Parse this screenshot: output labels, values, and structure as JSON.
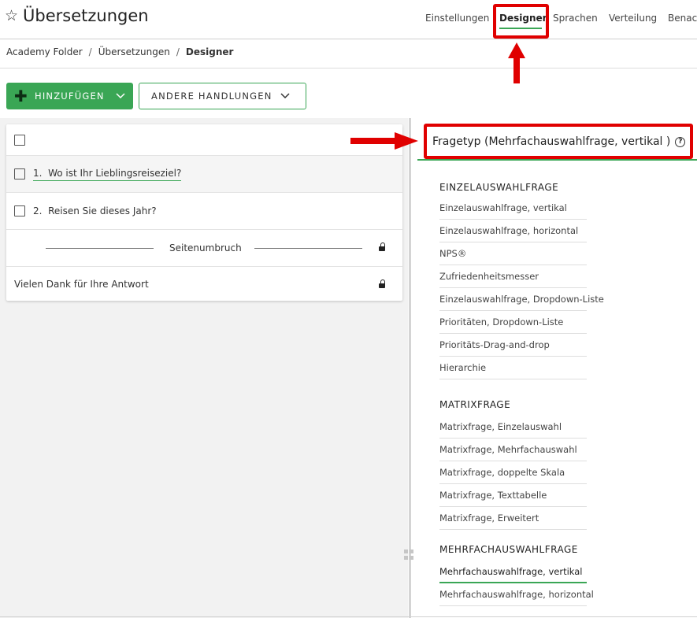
{
  "app": {
    "title": "Übersetzungen"
  },
  "nav": {
    "items": [
      {
        "label": "Einstellungen"
      },
      {
        "label": "Designer",
        "active": true
      },
      {
        "label": "Sprachen"
      },
      {
        "label": "Verteilung"
      },
      {
        "label": "Benac"
      }
    ]
  },
  "breadcrumb": {
    "items": [
      "Academy Folder",
      "Übersetzungen",
      "Designer"
    ],
    "separator": "/"
  },
  "toolbar": {
    "add_label": "HINZUFÜGEN",
    "other_label": "ANDERE HANDLUNGEN"
  },
  "survey": {
    "questions": [
      {
        "number": "1.",
        "text": "Wo ist Ihr Lieblingsreiseziel?"
      },
      {
        "number": "2.",
        "text": "Reisen Sie dieses Jahr?"
      }
    ],
    "page_break_label": "Seitenumbruch",
    "end_text": "Vielen Dank für Ihre Antwort"
  },
  "panel": {
    "title": "Fragetyp (Mehrfachauswahlfrage, vertikal )",
    "sections": [
      {
        "title": "EINZELAUSWAHLFRAGE",
        "items": [
          "Einzelauswahlfrage, vertikal",
          "Einzelauswahlfrage, horizontal",
          "NPS®",
          "Zufriedenheitsmesser",
          "Einzelauswahlfrage, Dropdown-Liste",
          "Prioritäten, Dropdown-Liste",
          "Prioritäts-Drag-and-drop",
          "Hierarchie"
        ]
      },
      {
        "title": "MATRIXFRAGE",
        "items": [
          "Matrixfrage, Einzelauswahl",
          "Matrixfrage, Mehrfachauswahl",
          "Matrixfrage, doppelte Skala",
          "Matrixfrage, Texttabelle",
          "Matrixfrage, Erweitert"
        ]
      },
      {
        "title": "MEHRFACHAUSWAHLFRAGE",
        "items": [
          "Mehrfachauswahlfrage, vertikal",
          "Mehrfachauswahlfrage, horizontal"
        ],
        "active_item": "Mehrfachauswahlfrage, vertikal"
      }
    ]
  },
  "colors": {
    "accent": "#3aa655",
    "annotation": "#e00000"
  }
}
